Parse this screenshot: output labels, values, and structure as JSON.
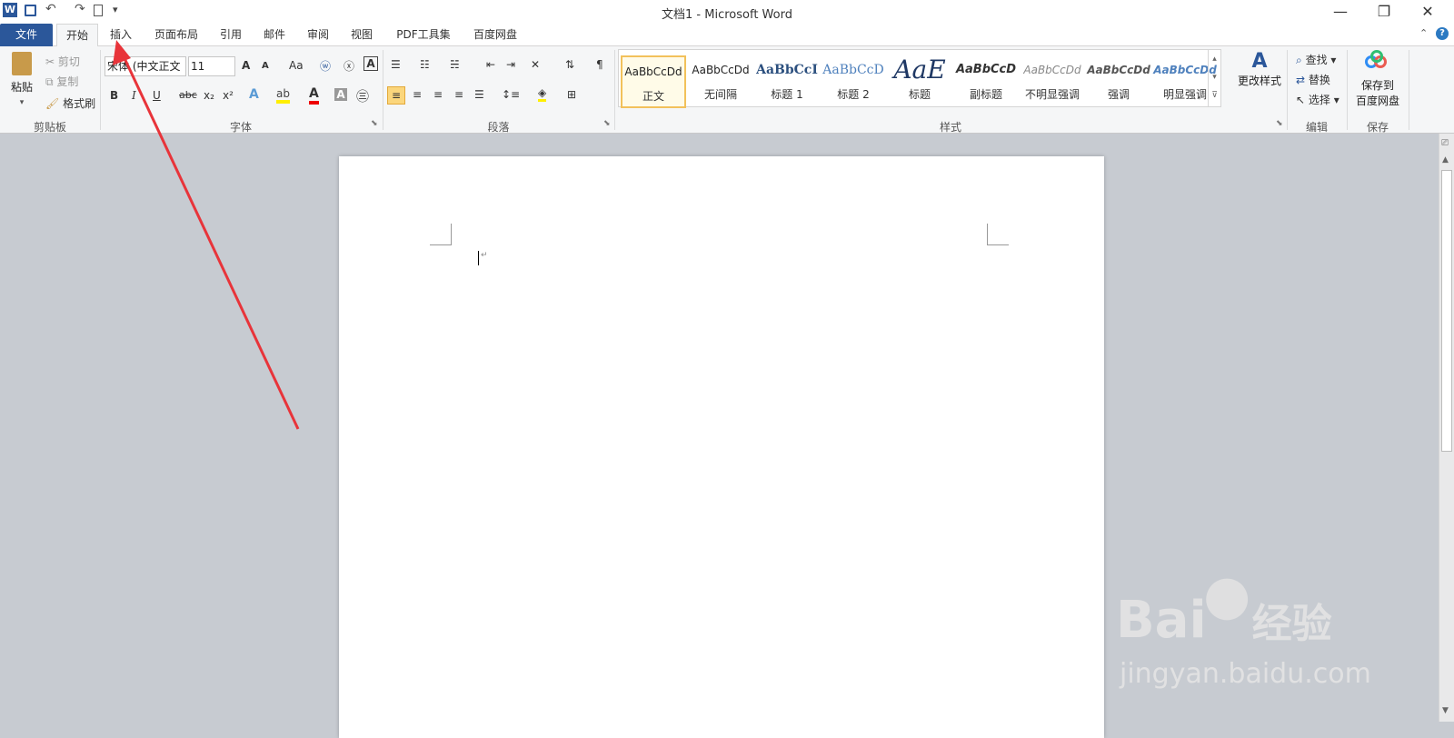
{
  "window": {
    "title": "文档1 - Microsoft Word",
    "minimize": "—",
    "restore": "❐",
    "close": "✕"
  },
  "qat": {
    "app_icon": "W",
    "customize": "▾"
  },
  "tabs": [
    {
      "label": "文件"
    },
    {
      "label": "开始"
    },
    {
      "label": "插入"
    },
    {
      "label": "页面布局"
    },
    {
      "label": "引用"
    },
    {
      "label": "邮件"
    },
    {
      "label": "审阅"
    },
    {
      "label": "视图"
    },
    {
      "label": "PDF工具集"
    },
    {
      "label": "百度网盘"
    }
  ],
  "clipboard": {
    "paste": "粘贴",
    "cut": "剪切",
    "copy": "复制",
    "format_painter": "格式刷",
    "group": "剪贴板"
  },
  "font": {
    "name": "宋体 (中文正文",
    "size": "11",
    "group": "字体",
    "bold": "B",
    "italic": "I",
    "underline": "U",
    "strike": "abc",
    "sub": "x₂",
    "sup": "x²",
    "grow": "A",
    "shrink": "A",
    "case": "Aa"
  },
  "paragraph": {
    "group": "段落"
  },
  "styles": {
    "group": "样式",
    "items": [
      {
        "sample": "AaBbCcDd",
        "name": "正文"
      },
      {
        "sample": "AaBbCcDd",
        "name": "无间隔"
      },
      {
        "sample": "AaBbCcI",
        "name": "标题 1"
      },
      {
        "sample": "AaBbCcD",
        "name": "标题 2"
      },
      {
        "sample": "AaE",
        "name": "标题"
      },
      {
        "sample": "AaBbCcD",
        "name": "副标题"
      },
      {
        "sample": "AaBbCcDd",
        "name": "不明显强调"
      },
      {
        "sample": "AaBbCcDd",
        "name": "强调"
      },
      {
        "sample": "AaBbCcDd",
        "name": "明显强调"
      }
    ],
    "change": "更改样式"
  },
  "editing": {
    "find": "查找",
    "replace": "替换",
    "select": "选择",
    "group": "编辑"
  },
  "save": {
    "label1": "保存到",
    "label2": "百度网盘",
    "group": "保存"
  },
  "watermark": {
    "brand": "Bai",
    "brand2": "经验",
    "url": "jingyan.baidu.com"
  },
  "colors": {
    "accent": "#2b579a",
    "arrow": "#e8343a"
  }
}
